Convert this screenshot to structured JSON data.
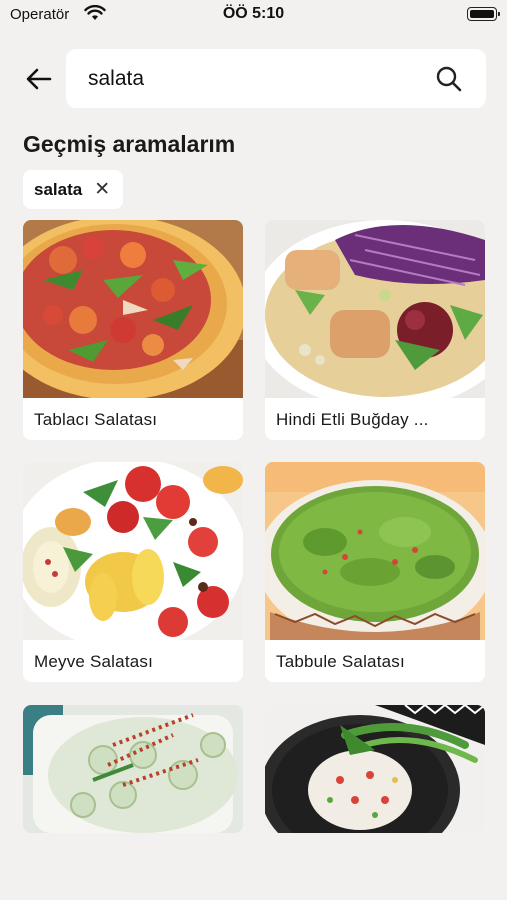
{
  "status_bar": {
    "carrier": "Operatör",
    "time": "ÖÖ 5:10"
  },
  "search": {
    "value": "salata",
    "back_icon": "arrow-left-icon",
    "search_icon": "magnifier-icon"
  },
  "history": {
    "title": "Geçmiş aramalarım",
    "chips": [
      {
        "label": "salata",
        "remove_icon": "close-icon"
      }
    ]
  },
  "results": [
    {
      "title": "Tablacı Salatası"
    },
    {
      "title": "Hindi Etli Buğday ..."
    },
    {
      "title": "Meyve Salatası"
    },
    {
      "title": "Tabbule Salatası"
    },
    {
      "title": ""
    },
    {
      "title": ""
    }
  ],
  "colors": {
    "background": "#f2f1f0",
    "card": "#ffffff",
    "text": "#1a1a1a"
  }
}
